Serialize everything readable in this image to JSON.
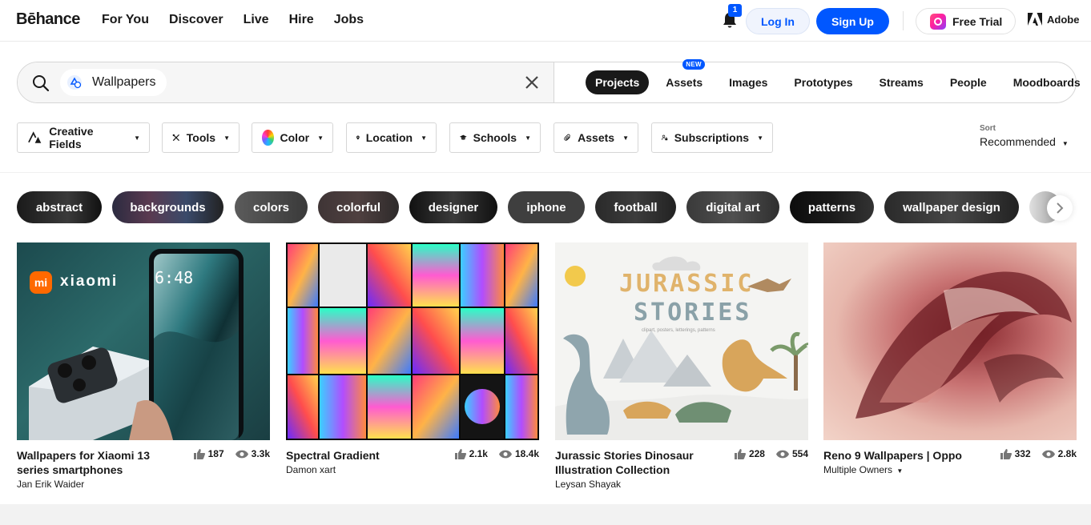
{
  "header": {
    "logo": "Bēhance",
    "nav": [
      "For You",
      "Discover",
      "Live",
      "Hire",
      "Jobs"
    ],
    "notification_count": "1",
    "login_label": "Log In",
    "signup_label": "Sign Up",
    "trial_label": "Free Trial",
    "adobe_label": "Adobe"
  },
  "search": {
    "query": "Wallpapers",
    "placeholder": "",
    "tabs": [
      "Projects",
      "Assets",
      "Images",
      "Prototypes",
      "Streams",
      "People",
      "Moodboards"
    ],
    "active_tab": "Projects",
    "new_badge": "NEW"
  },
  "filters": {
    "creative_fields": "Creative Fields",
    "tools": "Tools",
    "color": "Color",
    "location": "Location",
    "schools": "Schools",
    "assets": "Assets",
    "subscriptions": "Subscriptions",
    "sort_label": "Sort",
    "sort_value": "Recommended"
  },
  "tags": [
    "abstract",
    "backgrounds",
    "colors",
    "colorful",
    "designer",
    "iphone",
    "football",
    "digital art",
    "patterns",
    "wallpaper design"
  ],
  "projects": [
    {
      "title": "Wallpapers for Xiaomi 13 series smartphones",
      "owner": "Jan Erik Waider",
      "likes": "187",
      "views": "3.3k"
    },
    {
      "title": "Spectral Gradient",
      "owner": "Damon xart",
      "likes": "2.1k",
      "views": "18.4k"
    },
    {
      "title": "Jurassic Stories Dinosaur Illustration Collection",
      "owner": "Leysan Shayak",
      "likes": "228",
      "views": "554"
    },
    {
      "title": "Reno 9 Wallpapers | Oppo",
      "owner": "Multiple Owners",
      "likes": "332",
      "views": "2.8k"
    }
  ],
  "thumb_text": {
    "xiaomi_brand": "xiaomi",
    "xiaomi_brand_mark": "mi",
    "phone_time": "6:48",
    "jurassic_title_1": "JURASSIC",
    "jurassic_title_2": "STORIES",
    "jurassic_sub": "clipart, posters, letterings, patterns"
  },
  "colors": {
    "accent": "#0057ff",
    "text": "#191919"
  }
}
